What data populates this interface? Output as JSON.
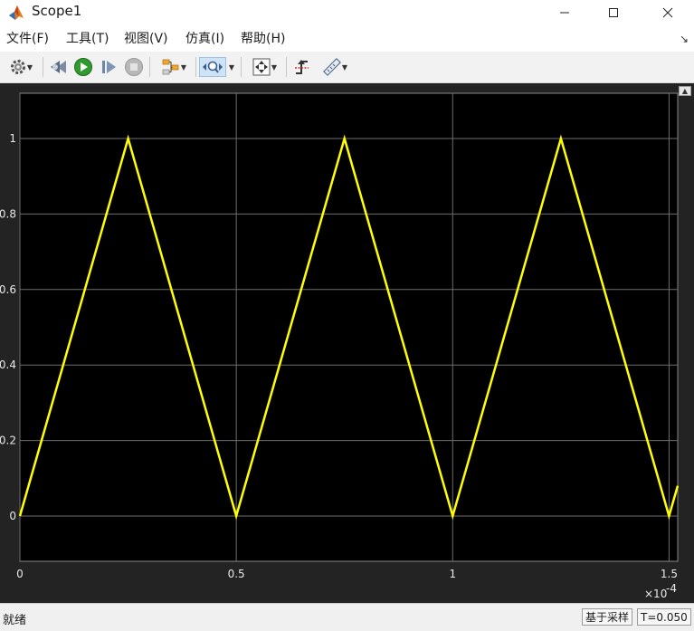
{
  "window": {
    "title": "Scope1",
    "controls": [
      "minimize-icon",
      "maximize-icon",
      "close-icon"
    ]
  },
  "menu": {
    "items": [
      "文件(F)",
      "工具(T)",
      "视图(V)",
      "仿真(I)",
      "帮助(H)"
    ]
  },
  "toolbar": {
    "icons": [
      "gear-icon",
      "step-back-icon",
      "run-icon",
      "step-forward-icon",
      "stop-icon",
      "signal-highlight-icon",
      "zoom-icon",
      "fit-to-view-icon",
      "triggers-icon",
      "measure-icon"
    ],
    "active": "zoom-icon"
  },
  "status": {
    "left": "就绪",
    "mode": "基于采样",
    "time": "T=0.050"
  },
  "colors": {
    "plot_bg": "#000000",
    "figure_bg": "#232323",
    "grid": "#6e6e6e",
    "signal": "#ffff00"
  },
  "chart_data": {
    "type": "line",
    "title": "",
    "xlabel": "",
    "ylabel": "",
    "x_exponent_label": "×10",
    "x_exponent": "-4",
    "xlim": [
      0,
      1.52
    ],
    "ylim": [
      -0.12,
      1.12
    ],
    "x_ticks": [
      0,
      0.5,
      1,
      1.5
    ],
    "x_tick_labels": [
      "0",
      "0.5",
      "1",
      "1.5"
    ],
    "y_ticks": [
      0,
      0.2,
      0.4,
      0.6,
      0.8,
      1
    ],
    "y_tick_labels": [
      "0",
      "0.2",
      "0.4",
      "0.6",
      "0.8",
      "1"
    ],
    "grid": true,
    "series": [
      {
        "color": "#ffff00",
        "x": [
          0,
          0.25,
          0.5,
          0.75,
          1.0,
          1.25,
          1.5,
          1.52
        ],
        "y": [
          0,
          1,
          0,
          1,
          0,
          1,
          0,
          0.08
        ]
      }
    ]
  }
}
